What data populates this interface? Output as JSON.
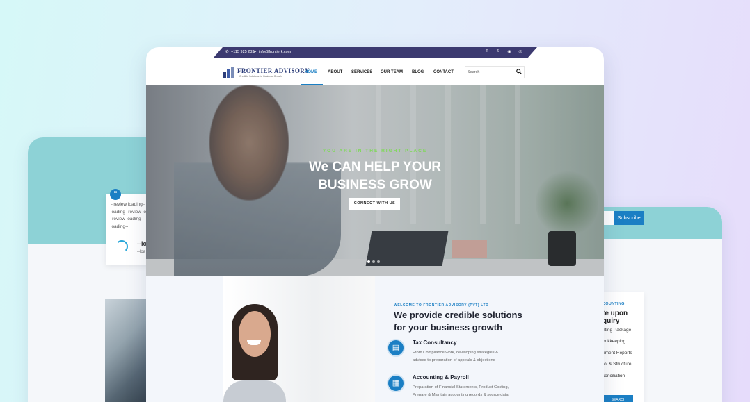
{
  "back_left": {
    "review_lines": [
      "--review loading--",
      "loading--review lo",
      "-review loading--",
      "loading--"
    ],
    "quote_glyph": "“",
    "loading_big": "--lo",
    "loading_small": "--loa"
  },
  "back_right": {
    "subscribe_label": "Subscribe",
    "tag": "COUNTING",
    "heading_lines": [
      "te upon",
      "quiry"
    ],
    "items": [
      "nting Package",
      "ookkeeping",
      "ement Reports",
      "rol & Structure",
      "conciliation"
    ],
    "button_label": "SEARCH"
  },
  "topbar": {
    "phone": "+115 925 233",
    "email": "info@frontierk.com",
    "social": [
      "f",
      "t",
      "ig",
      "p"
    ]
  },
  "brand": {
    "name": "FRONTIER ADVISORY",
    "tagline": "Credible Solutions for Business Growth",
    "accent": "#1b7fc4",
    "topbar_color": "#3c3a70"
  },
  "nav": {
    "items": [
      "HOME",
      "ABOUT",
      "SERVICES",
      "OUR TEAM",
      "BLOG",
      "CONTACT"
    ],
    "active": "HOME",
    "search_placeholder": "Search"
  },
  "hero": {
    "kicker": "YOU ARE IN THE RIGHT PLACE",
    "title_line1": "We CAN HELP YOUR",
    "title_line2": "BUSINESS GROW",
    "cta": "CONNECT WITH US",
    "slides": 3,
    "active_slide": 1
  },
  "about": {
    "tag": "WELCOME TO FRONTIER ADVISORY (PVT) LTD",
    "heading_line1": "We provide credible solutions",
    "heading_line2": "for your business growth",
    "services": [
      {
        "title": "Tax Consultancy",
        "desc_line1": "From Compliance work, developing strategies &",
        "desc_line2": "advises to preparation of appeals & objections",
        "icon": "chart-person-icon"
      },
      {
        "title": "Accounting & Payroll",
        "desc_line1": "Preparation of Financial Statements, Product Costing,",
        "desc_line2": "Prepare & Maintain accounting records & source data",
        "icon": "calculator-icon"
      }
    ]
  }
}
